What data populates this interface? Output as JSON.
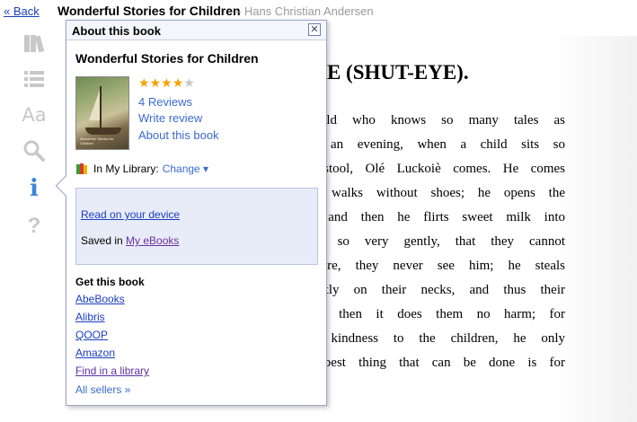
{
  "topbar": {
    "back_label": "« Back",
    "book_title": "Wonderful Stories for Children",
    "author_line": "– Hans Christian Andersen"
  },
  "tools": [
    {
      "icon": "library-icon"
    },
    {
      "icon": "contents-icon"
    },
    {
      "icon": "font-size-icon",
      "label": "Aa"
    },
    {
      "icon": "search-icon"
    },
    {
      "icon": "info-icon",
      "label": "i"
    },
    {
      "icon": "help-icon",
      "label": "?"
    }
  ],
  "page": {
    "chapter_title": "IE (SHUT-EYE).",
    "lines": [
      "world who knows so many tales as",
      "In an evening, when a child sits so",
      "e stool, Olé Luckoiè comes. He comes",
      "he walks without shoes; he opens the",
      "e, and then he flirts sweet milk into",
      "tly, so very gently, that they cannot",
      "refore, they never see him; he steals",
      "gently on their necks, and thus their",
      "But then it does them no harm; for",
      "ut kindness to the children, he only",
      "e best thing that can be done is for"
    ]
  },
  "popup": {
    "header_title": "About this book",
    "close_symbol": "✕",
    "book_title": "Wonderful Stories for Children",
    "cover_text": "Wonderful Stories for Children",
    "rating_stars": 4,
    "rating_max": 5,
    "reviews_label": "4 Reviews",
    "write_review_label": "Write review",
    "about_label": "About this book",
    "library_label": "In My Library:",
    "change_label": "Change ▾",
    "read_device_label": "Read on your device",
    "saved_prefix": "Saved in",
    "saved_link": "My eBooks",
    "get_heading": "Get this book",
    "sellers": [
      "AbeBooks",
      "Alibris",
      "QOOP",
      "Amazon",
      "Find in a library"
    ],
    "all_sellers_label": "All sellers »"
  },
  "colors": {
    "link": "#1a3dc1",
    "visited": "#5b2ea6",
    "star": "#f5a100",
    "tool_icon": "#cccccc",
    "info_icon_active": "#3a86d6"
  }
}
